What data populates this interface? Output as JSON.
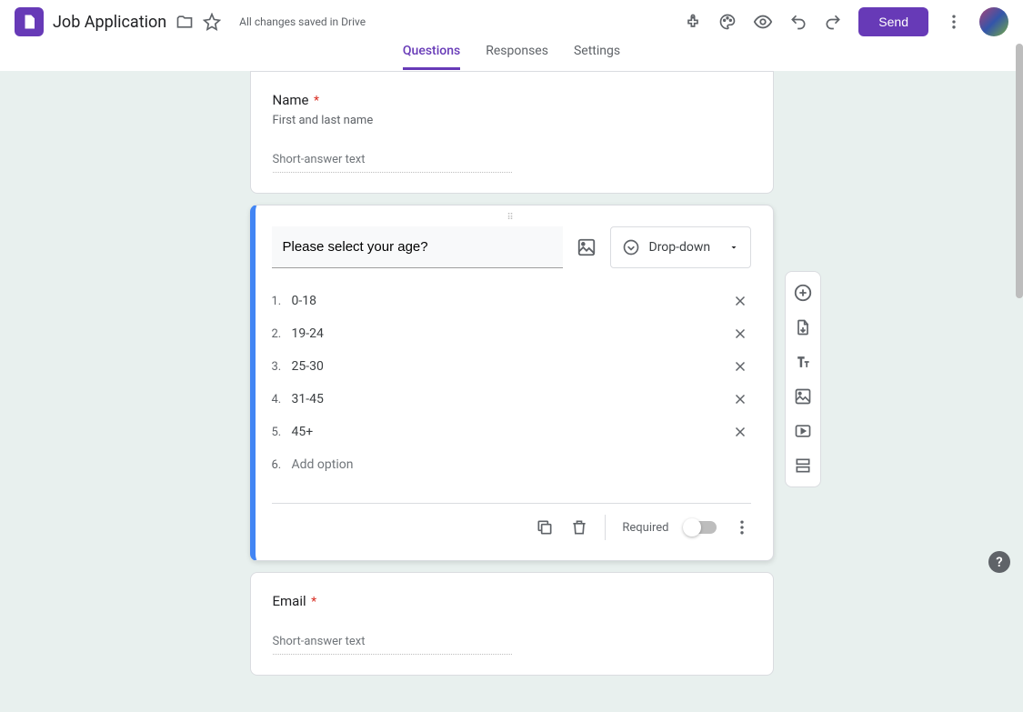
{
  "header": {
    "form_title": "Job Application",
    "save_status": "All changes saved in Drive",
    "send_label": "Send"
  },
  "tabs": {
    "questions": "Questions",
    "responses": "Responses",
    "settings": "Settings"
  },
  "q_name": {
    "title": "Name",
    "required_mark": "*",
    "desc": "First and last name",
    "placeholder": "Short-answer text"
  },
  "q_age": {
    "title": "Please select your age?",
    "type_label": "Drop-down",
    "options": [
      {
        "num": "1.",
        "val": "0-18"
      },
      {
        "num": "2.",
        "val": "19-24"
      },
      {
        "num": "3.",
        "val": "25-30"
      },
      {
        "num": "4.",
        "val": "31-45"
      },
      {
        "num": "5.",
        "val": "45+"
      }
    ],
    "add_num": "6.",
    "add_label": "Add option",
    "required_label": "Required"
  },
  "q_email": {
    "title": "Email",
    "required_mark": "*",
    "placeholder": "Short-answer text"
  }
}
